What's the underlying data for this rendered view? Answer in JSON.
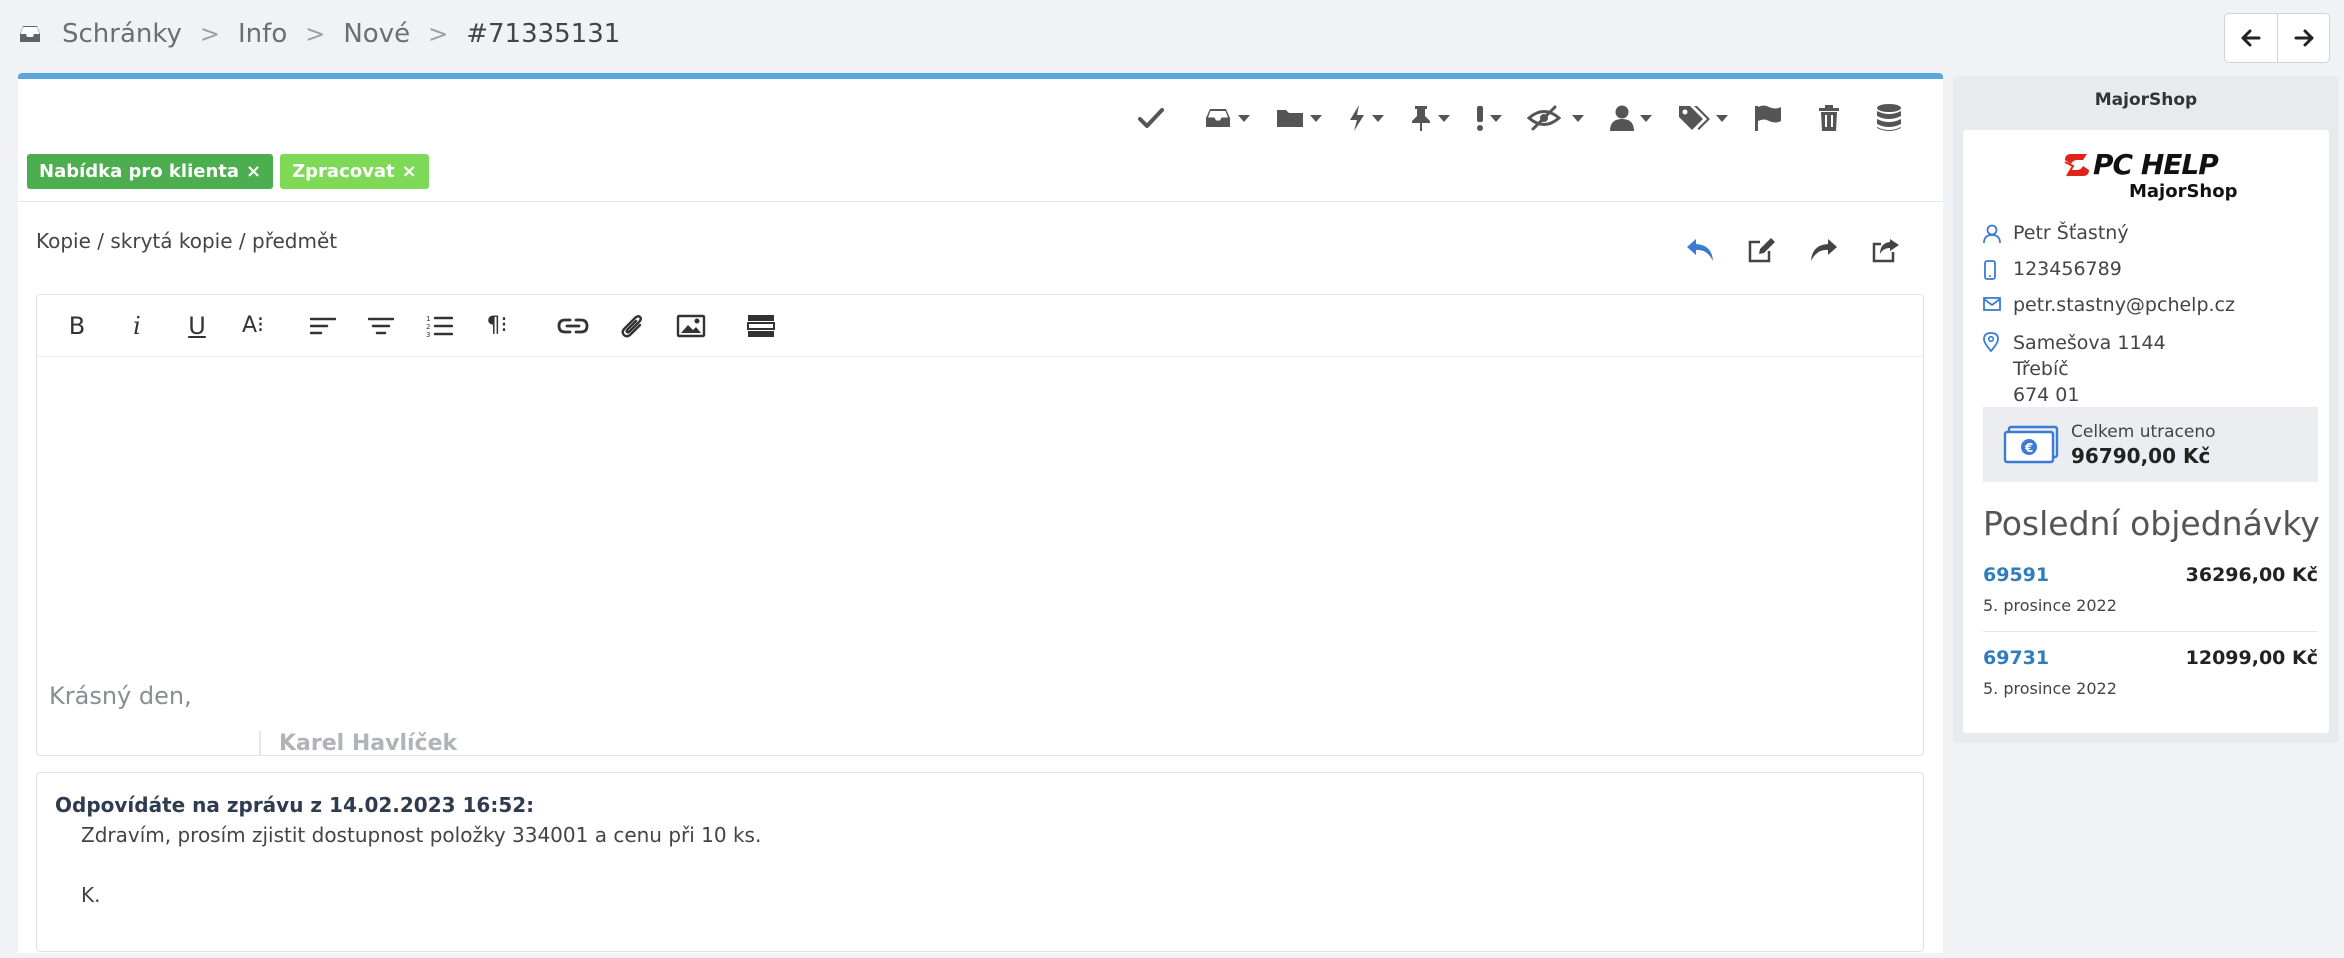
{
  "breadcrumb": {
    "items": [
      "Schránky",
      "Info",
      "Nové",
      "#71335131"
    ],
    "separator": ">"
  },
  "nav": {
    "back_icon": "arrow-left-icon",
    "forward_icon": "arrow-right-icon"
  },
  "toolbar": {
    "icons": [
      "check-icon",
      "inbox-icon",
      "folder-icon",
      "bolt-icon",
      "pin-icon",
      "exclamation-icon",
      "eye-slash-icon",
      "user-icon",
      "tags-icon",
      "flag-icon",
      "trash-icon",
      "database-icon"
    ]
  },
  "tags": [
    {
      "label": "Nabídka pro klienta",
      "color": "#4cae4f"
    },
    {
      "label": "Zpracovat",
      "color": "#7ed957"
    }
  ],
  "tag_remove": "×",
  "compose": {
    "cc_link": "Kopie / skrytá kopie / předmět",
    "signature_greeting": "Krásný den,",
    "signature_name": "Karel Havlíček"
  },
  "editor_toolbar": {
    "bold": "B",
    "italic": "i",
    "underline": "U",
    "font_size": "A⁝",
    "paragraph": "¶⁝"
  },
  "quoted": {
    "header": "Odpovídáte na zprávu z 14.02.2023 16:52:",
    "line1": "Zdravím, prosím zjistit dostupnost položky 334001 a cenu při 10 ks.",
    "line2": "K."
  },
  "shop": {
    "panel_title": "MajorShop",
    "logo_brand": "PC HELP",
    "logo_sub": "MajorShop",
    "customer_name": "Petr Šťastný",
    "phone": "123456789",
    "email": "petr.stastny@pchelp.cz",
    "address_street": "Samešova 1144",
    "address_city": "Třebíč",
    "address_zip": "674 01",
    "spent_label": "Celkem utraceno",
    "spent_value": "96790,00 Kč",
    "orders_title": "Poslední objednávky",
    "orders": [
      {
        "id": "69591",
        "price": "36296,00 Kč",
        "date": "5. prosince 2022"
      },
      {
        "id": "69731",
        "price": "12099,00 Kč",
        "date": "5. prosince 2022"
      }
    ]
  },
  "colors": {
    "accent": "#5aa5dc",
    "link": "#2f7dbd",
    "brand_red": "#e2231a",
    "reply_blue": "#3a7bd5"
  }
}
